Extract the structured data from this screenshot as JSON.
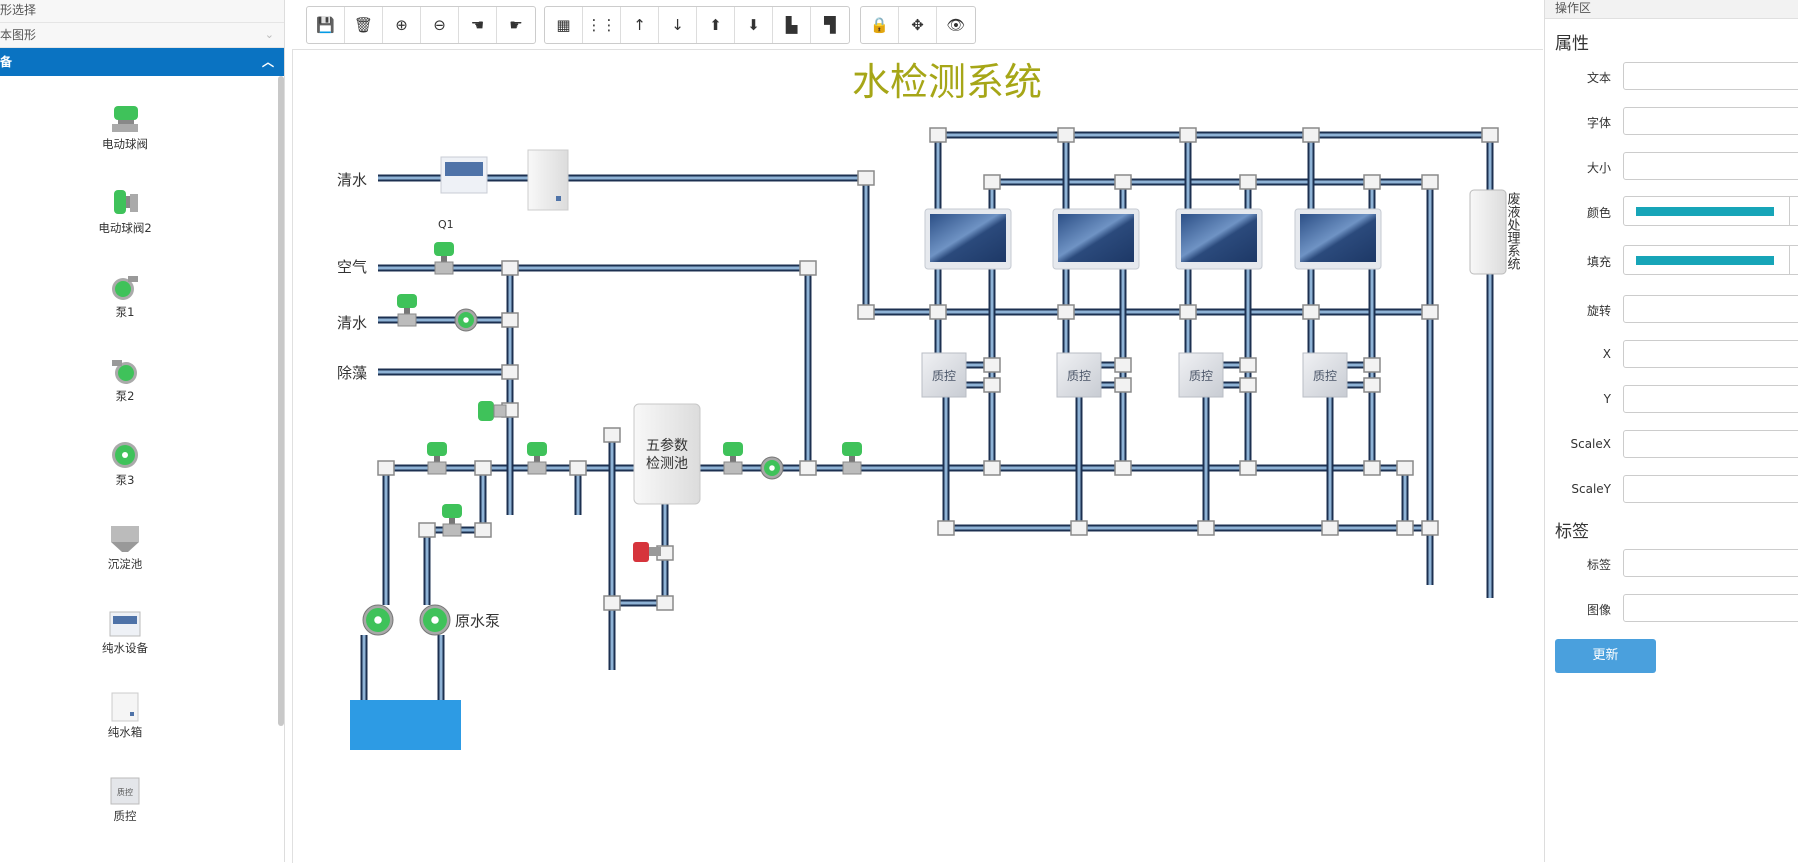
{
  "palette": {
    "header_shape_select": "形选择",
    "header_basic_shapes": "本图形",
    "header_active": "备",
    "items": [
      {
        "label": "电动球阀",
        "icon": "electric-ball-valve-icon"
      },
      {
        "label": "电动球阀2",
        "icon": "electric-ball-valve-2-icon"
      },
      {
        "label": "泵1",
        "icon": "pump-1-icon"
      },
      {
        "label": "泵2",
        "icon": "pump-2-icon"
      },
      {
        "label": "泵3",
        "icon": "pump-3-icon"
      },
      {
        "label": "沉淀池",
        "icon": "sedimentation-tank-icon"
      },
      {
        "label": "纯水设备",
        "icon": "pure-water-equipment-icon"
      },
      {
        "label": "纯水箱",
        "icon": "pure-water-tank-icon"
      },
      {
        "label": "质控",
        "icon": "quality-control-icon"
      }
    ]
  },
  "toolbar": {
    "groups": [
      [
        "save-icon",
        "trash-icon",
        "zoom-in-icon",
        "zoom-out-icon",
        "hand-left-icon",
        "hand-right-icon"
      ],
      [
        "grid-large-icon",
        "grid-small-icon",
        "arrow-up-icon",
        "arrow-down-icon",
        "circle-up-icon",
        "circle-down-icon",
        "align-left-icon",
        "align-top-icon"
      ],
      [
        "lock-icon",
        "move-icon",
        "eye-icon"
      ]
    ]
  },
  "diagram": {
    "title": "水检测系统",
    "title_color": "#a6a617",
    "labels": {
      "clear_water_1": "清水",
      "air": "空气",
      "clear_water_2": "清水",
      "algae_removal": "除藻",
      "q1": "Q1",
      "raw_pump": "原水泵",
      "five_param_pool_line1": "五参数",
      "five_param_pool_line2": "检测池",
      "quality_control": "质控",
      "waste_system": "废液处理系统"
    }
  },
  "right_panel": {
    "header": "操作区",
    "section_properties": "属性",
    "fields": [
      {
        "label": "文本",
        "type": "text"
      },
      {
        "label": "字体",
        "type": "text"
      },
      {
        "label": "大小",
        "type": "text"
      },
      {
        "label": "颜色",
        "type": "color",
        "value": "#17a5b8"
      },
      {
        "label": "填充",
        "type": "color",
        "value": "#17a5b8"
      },
      {
        "label": "旋转",
        "type": "text"
      },
      {
        "label": "X",
        "type": "text"
      },
      {
        "label": "Y",
        "type": "text"
      },
      {
        "label": "ScaleX",
        "type": "text"
      },
      {
        "label": "ScaleY",
        "type": "text"
      }
    ],
    "section_tags": "标签",
    "tag_fields": [
      {
        "label": "标签"
      },
      {
        "label": "图像"
      }
    ],
    "update_button": "更新"
  }
}
